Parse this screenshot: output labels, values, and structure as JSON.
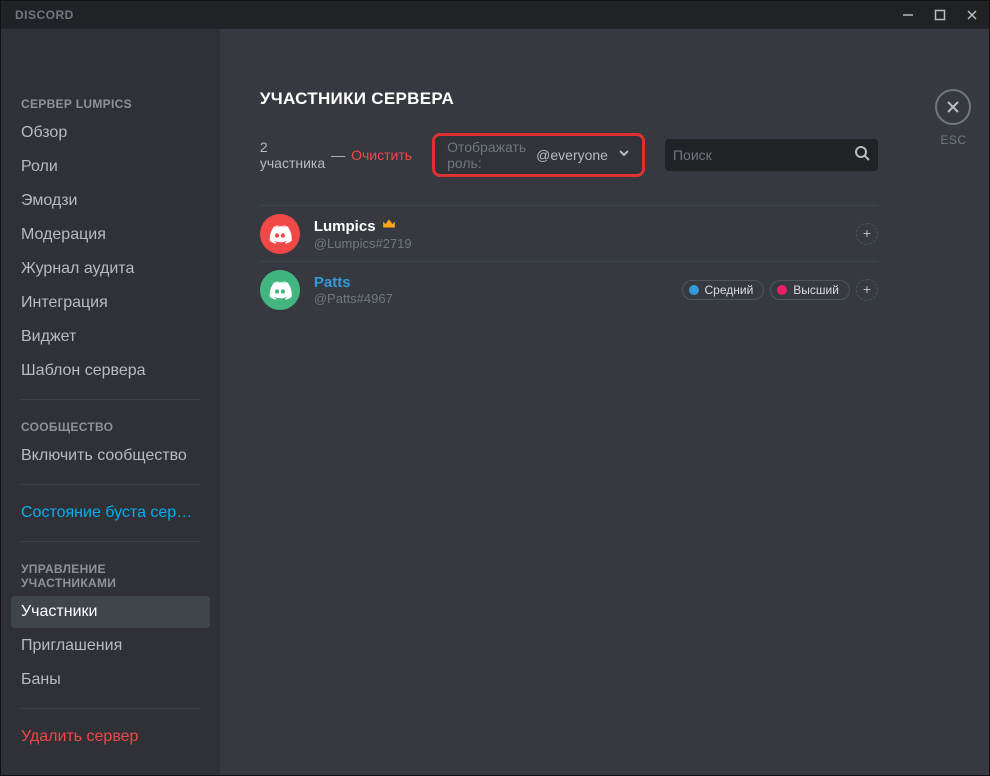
{
  "titlebar": {
    "brand": "DISCORD"
  },
  "sidebar": {
    "group1_header": "СЕРВЕР LUMPICS",
    "group1": [
      {
        "label": "Обзор"
      },
      {
        "label": "Роли"
      },
      {
        "label": "Эмодзи"
      },
      {
        "label": "Модерация"
      },
      {
        "label": "Журнал аудита"
      },
      {
        "label": "Интеграция"
      },
      {
        "label": "Виджет"
      },
      {
        "label": "Шаблон сервера"
      }
    ],
    "group2_header": "СООБЩЕСТВО",
    "group2": [
      {
        "label": "Включить сообщество"
      }
    ],
    "boost_link": "Состояние буста серв…",
    "group3_header": "УПРАВЛЕНИЕ УЧАСТНИКАМИ",
    "group3": [
      {
        "label": "Участники",
        "selected": true
      },
      {
        "label": "Приглашения"
      },
      {
        "label": "Баны"
      }
    ],
    "delete_label": "Удалить сервер"
  },
  "content": {
    "title": "УЧАСТНИКИ СЕРВЕРА",
    "member_count": "2 участника",
    "dash": "—",
    "clear": "Очистить",
    "role_filter_label": "Отображать роль:",
    "role_filter_value": "@everyone",
    "search_placeholder": "Поиск",
    "members": [
      {
        "name": "Lumpics",
        "tag": "@Lumpics#2719",
        "avatar_color": "red",
        "name_color": "white",
        "owner": true,
        "roles": []
      },
      {
        "name": "Patts",
        "tag": "@Patts#4967",
        "avatar_color": "green",
        "name_color": "blue",
        "owner": false,
        "roles": [
          {
            "label": "Средний",
            "color": "#3498db"
          },
          {
            "label": "Высший",
            "color": "#e91e63"
          }
        ]
      }
    ]
  },
  "close": {
    "esc": "ESC"
  }
}
